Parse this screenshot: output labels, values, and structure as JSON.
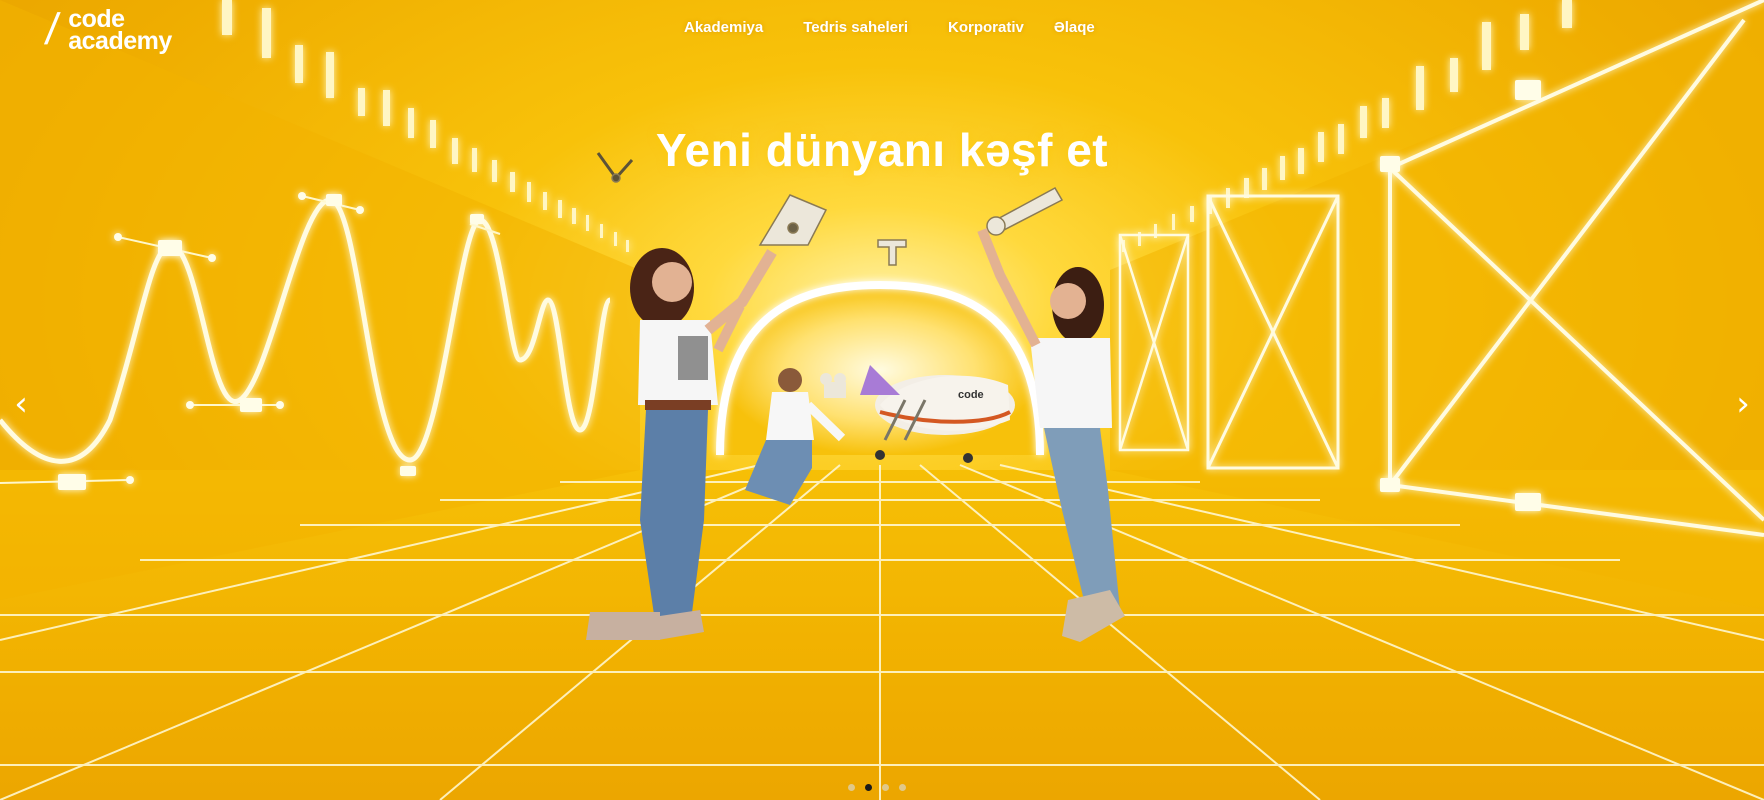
{
  "brand": {
    "logo_top": "code",
    "logo_bottom": "academy"
  },
  "nav": {
    "items": [
      {
        "label": "Akademiya"
      },
      {
        "label": "Tedris saheleri"
      },
      {
        "label": "Korporativ"
      },
      {
        "label": "Əlaqe"
      }
    ]
  },
  "hero": {
    "headline": "Yeni dünyanı kəşf et",
    "accent_color": "#f5b800",
    "slides_total": 4,
    "active_slide": 2
  },
  "icons": {
    "prev": "chevron-left-icon",
    "next": "chevron-right-icon"
  }
}
